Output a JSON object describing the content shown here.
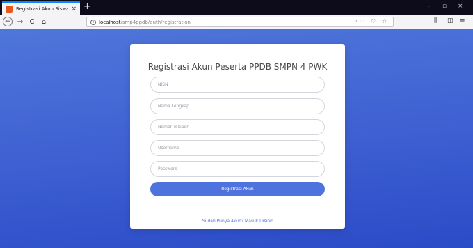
{
  "browser": {
    "tab_title": "Registrasi Akun Siswa",
    "tab_close": "×",
    "new_tab": "+",
    "url_host": "localhost",
    "url_path": "/smp4ppdb/auth/registration",
    "url_actions": "··· ♡ ☆",
    "window_controls": {
      "minimize": "–",
      "maximize": "▫",
      "close": "×"
    },
    "toolbar_right": {
      "library": "⫼",
      "sidebar": "◫",
      "menu": "≡"
    },
    "nav": {
      "back": "←",
      "forward": "→",
      "reload": "C",
      "home": "⌂"
    },
    "info": "i"
  },
  "form": {
    "title": "Registrasi Akun Peserta PPDB SMPN 4 PWK",
    "nisn_placeholder": "NISN",
    "nama_placeholder": "Nama Lengkap",
    "telepon_placeholder": "Nomor Telepon",
    "username_placeholder": "Username",
    "password_placeholder": "Password",
    "submit_label": "Registrasi Akun",
    "login_link": "Sudah Punya Akun? Masuk Disini!"
  },
  "colors": {
    "accent": "#4e73df",
    "page_gradient_top": "#4f76da",
    "page_gradient_bottom": "#2a4bc6",
    "tabbar": "#0c0c1a"
  }
}
